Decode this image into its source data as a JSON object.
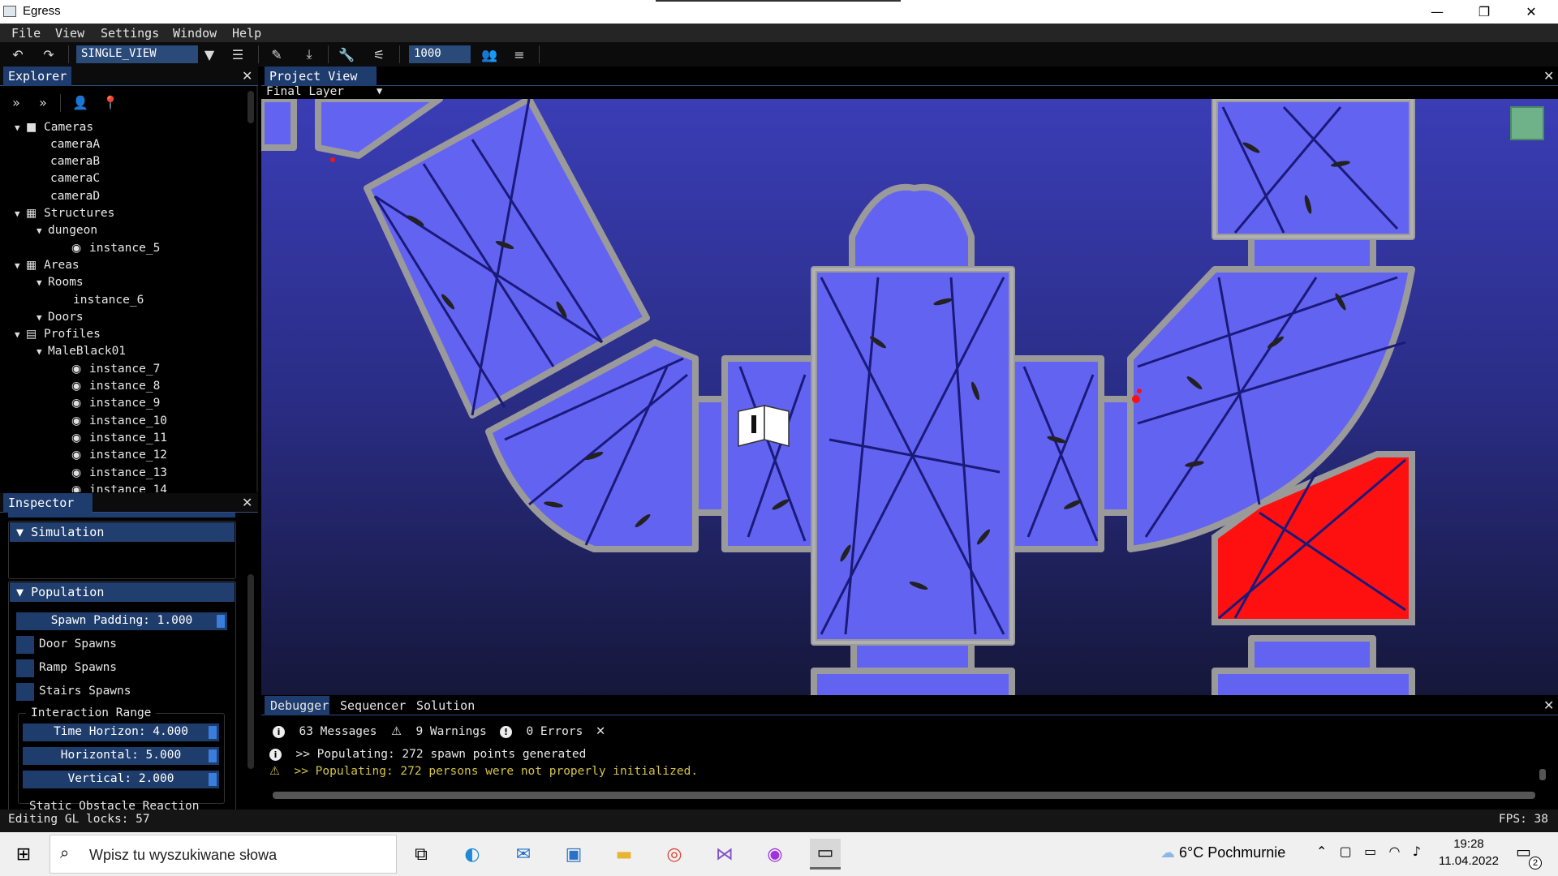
{
  "window": {
    "title": "Egress",
    "minimize": "—",
    "maximize": "❐",
    "close": "✕"
  },
  "menu": [
    "File",
    "View",
    "Settings",
    "Window",
    "Help"
  ],
  "toolbar": {
    "view_mode": "SINGLE_VIEW",
    "count_value": "1000"
  },
  "explorer": {
    "tab": "Explorer",
    "tree": [
      {
        "label": "Cameras",
        "level": 0,
        "arrow": "▼",
        "icon": "camera-icon"
      },
      {
        "label": "cameraA",
        "level": 1
      },
      {
        "label": "cameraB",
        "level": 1
      },
      {
        "label": "cameraC",
        "level": 1
      },
      {
        "label": "cameraD",
        "level": 1
      },
      {
        "label": "Structures",
        "level": 0,
        "arrow": "▼",
        "icon": "building-icon"
      },
      {
        "label": "dungeon",
        "level": 1,
        "arrow": "▼"
      },
      {
        "label": "instance_5",
        "level": 2,
        "icon": "eye-icon"
      },
      {
        "label": "Areas",
        "level": 0,
        "arrow": "▼",
        "icon": "building-icon"
      },
      {
        "label": "Rooms",
        "level": 1,
        "arrow": "▼"
      },
      {
        "label": "instance_6",
        "level": 2
      },
      {
        "label": "Doors",
        "level": 1,
        "arrow": "▼"
      },
      {
        "label": "Profiles",
        "level": 0,
        "arrow": "▼",
        "icon": "id-card-icon"
      },
      {
        "label": "MaleBlack01",
        "level": 1,
        "arrow": "▼"
      },
      {
        "label": "instance_7",
        "level": 2,
        "icon": "eye-icon"
      },
      {
        "label": "instance_8",
        "level": 2,
        "icon": "eye-icon"
      },
      {
        "label": "instance_9",
        "level": 2,
        "icon": "eye-icon"
      },
      {
        "label": "instance_10",
        "level": 2,
        "icon": "eye-icon"
      },
      {
        "label": "instance_11",
        "level": 2,
        "icon": "eye-icon"
      },
      {
        "label": "instance_12",
        "level": 2,
        "icon": "eye-icon"
      },
      {
        "label": "instance_13",
        "level": 2,
        "icon": "eye-icon"
      },
      {
        "label": "instance_14",
        "level": 2,
        "icon": "eye-icon"
      }
    ]
  },
  "inspector": {
    "tab": "Inspector",
    "simulation_label": "Simulation",
    "population_label": "Population",
    "spawn_padding": "Spawn Padding: 1.000",
    "door_spawns": "Door Spawns",
    "ramp_spawns": "Ramp Spawns",
    "stairs_spawns": "Stairs Spawns",
    "interaction_range": "Interaction Range",
    "time_horizon": "Time Horizon: 4.000",
    "horizontal": "Horizontal: 5.000",
    "vertical": "Vertical: 2.000",
    "static_obstacle": "Static Obstacle Reaction"
  },
  "status": {
    "left": "Editing GL locks: 57",
    "fps": "FPS: 38"
  },
  "project_view": {
    "tab": "Project View",
    "layer": "Final Layer"
  },
  "debugger": {
    "tabs": [
      "Debugger",
      "Sequencer",
      "Solution"
    ],
    "messages_count": "63 Messages",
    "warnings_count": "9 Warnings",
    "errors_count": "0 Errors",
    "log": [
      {
        "type": "info",
        "text": ">> Populating: 272 spawn points generated"
      },
      {
        "type": "warning",
        "text": ">> Populating: 272 persons were not properly initialized."
      }
    ]
  },
  "taskbar": {
    "search_placeholder": "Wpisz tu wyszukiwane słowa",
    "weather": "6°C  Pochmurnie",
    "time": "19:28",
    "date": "11.04.2022",
    "notifications": "2"
  },
  "colors": {
    "accent": "#1e3c6e",
    "floor": "#6363f2",
    "wall": "#9a9a9a",
    "highlight": "#ff1010"
  }
}
